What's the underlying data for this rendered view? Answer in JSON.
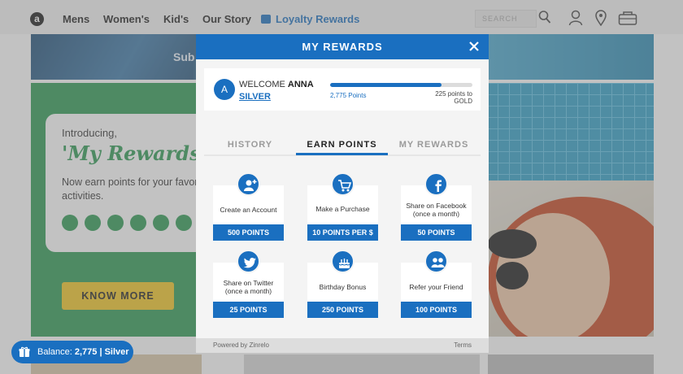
{
  "nav": {
    "logo": "a",
    "links": [
      "Mens",
      "Women's",
      "Kid's",
      "Our Story"
    ],
    "loyalty": "Loyalty Rewards",
    "search_placeholder": "SEARCH"
  },
  "hero": {
    "banner_text": "Sub"
  },
  "promo": {
    "intro": "Introducing,",
    "title": "'My Rewards'",
    "description": "Now earn points for your favorite activities.",
    "button": "KNOW MORE"
  },
  "modal": {
    "title": "MY REWARDS",
    "close_icon": "close-icon",
    "profile": {
      "avatar_letter": "A",
      "welcome_prefix": "WELCOME",
      "name": "ANNA",
      "tier": "SILVER",
      "points_label": "2,775 Points",
      "next_tier_line1": "225 points to",
      "next_tier_line2": "GOLD",
      "progress": 0.78
    },
    "tabs": [
      {
        "label": "HISTORY",
        "active": false
      },
      {
        "label": "EARN POINTS",
        "active": true
      },
      {
        "label": "MY REWARDS",
        "active": false
      }
    ],
    "tiles": [
      {
        "icon": "add-user-icon",
        "label": "Create an Account",
        "label2": "",
        "points": "500 POINTS"
      },
      {
        "icon": "cart-icon",
        "label": "Make a Purchase",
        "label2": "",
        "points": "10 POINTS PER $"
      },
      {
        "icon": "facebook-icon",
        "label": "Share on Facebook",
        "label2": "(once a month)",
        "points": "50 POINTS"
      },
      {
        "icon": "twitter-icon",
        "label": "Share on Twitter",
        "label2": "(once a month)",
        "points": "25 POINTS"
      },
      {
        "icon": "birthday-cake-icon",
        "label": "Birthday Bonus",
        "label2": "",
        "points": "250 POINTS"
      },
      {
        "icon": "refer-friend-icon",
        "label": "Refer your Friend",
        "label2": "",
        "points": "100 POINTS"
      }
    ],
    "footer": {
      "powered": "Powered by Zinrelo",
      "terms": "Terms"
    }
  },
  "balance": {
    "prefix": "Balance:",
    "value": "2,775 | Silver"
  },
  "colors": {
    "brand_blue": "#1a6fc0",
    "promo_green": "#2c9a52",
    "cta_yellow": "#f2c724"
  }
}
